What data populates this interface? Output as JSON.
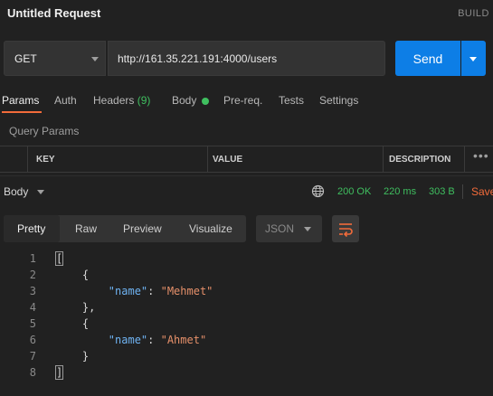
{
  "header": {
    "title": "Untitled Request",
    "build_label": "BUILD"
  },
  "request": {
    "method": "GET",
    "url": "http://161.35.221.191:4000/users",
    "send_label": "Send"
  },
  "tabs": [
    {
      "label": "Params",
      "active": true
    },
    {
      "label": "Auth"
    },
    {
      "label": "Headers",
      "count": "(9)"
    },
    {
      "label": "Body"
    },
    {
      "label": "Pre-req."
    },
    {
      "label": "Tests"
    },
    {
      "label": "Settings"
    }
  ],
  "params": {
    "section_label": "Query Params",
    "columns": [
      "KEY",
      "VALUE",
      "DESCRIPTION"
    ],
    "more_icon": "•••"
  },
  "response": {
    "body_label": "Body",
    "status": "200 OK",
    "time": "220 ms",
    "size": "303 B",
    "save_label": "Save"
  },
  "view": {
    "options": [
      "Pretty",
      "Raw",
      "Preview",
      "Visualize"
    ],
    "active": "Pretty",
    "format": "JSON"
  },
  "code": {
    "line_numbers": [
      "1",
      "2",
      "3",
      "4",
      "5",
      "6",
      "7",
      "8"
    ],
    "lines": [
      {
        "parts": [
          [
            "[",
            "brk"
          ]
        ]
      },
      {
        "parts": [
          [
            "    {",
            "p"
          ]
        ]
      },
      {
        "parts": [
          [
            "        ",
            "p"
          ],
          [
            "\"name\"",
            "key"
          ],
          [
            ": ",
            "p"
          ],
          [
            "\"Mehmet\"",
            "str"
          ]
        ]
      },
      {
        "parts": [
          [
            "    },",
            "p"
          ]
        ]
      },
      {
        "parts": [
          [
            "    {",
            "p"
          ]
        ]
      },
      {
        "parts": [
          [
            "        ",
            "p"
          ],
          [
            "\"name\"",
            "key"
          ],
          [
            ": ",
            "p"
          ],
          [
            "\"Ahmet\"",
            "str"
          ]
        ]
      },
      {
        "parts": [
          [
            "    }",
            "p"
          ]
        ]
      },
      {
        "parts": [
          [
            "]",
            "brk"
          ]
        ]
      }
    ]
  },
  "colors": {
    "accent": "#f26b3a",
    "send": "#0d7ee6",
    "success": "#3fbf5f"
  }
}
